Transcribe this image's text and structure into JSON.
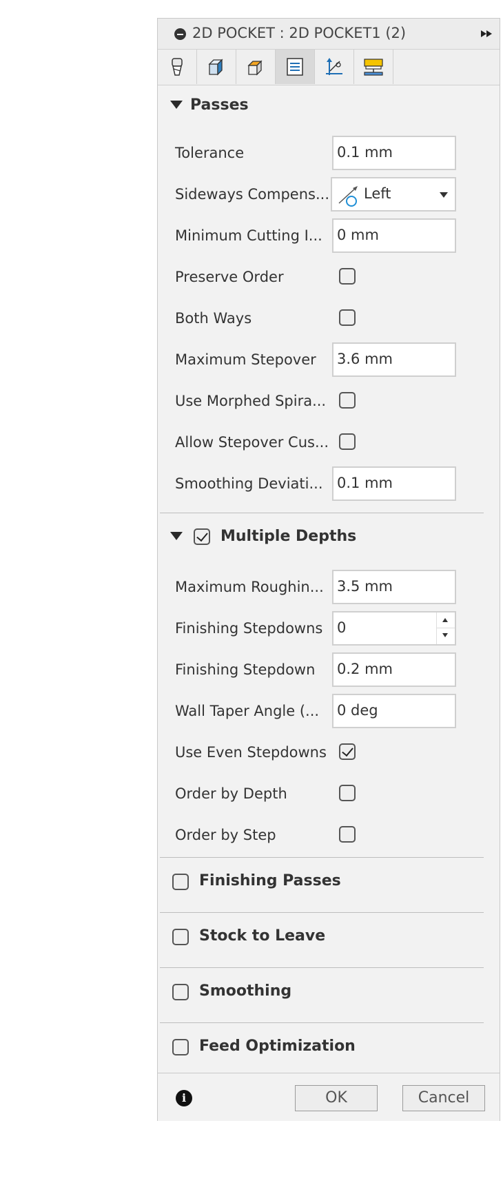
{
  "titlebar": {
    "title": "2D POCKET : 2D POCKET1 (2)",
    "collapse_icon": "collapse-icon",
    "expand_icon": "double-arrow-right-icon"
  },
  "tabs": [
    {
      "name": "tool-tab",
      "icon": "tool-icon",
      "active": false
    },
    {
      "name": "geometry-tab",
      "icon": "geometry-icon",
      "active": false
    },
    {
      "name": "heights-tab",
      "icon": "heights-icon",
      "active": false
    },
    {
      "name": "passes-tab",
      "icon": "passes-icon",
      "active": true
    },
    {
      "name": "linking-tab",
      "icon": "linking-icon",
      "active": false
    },
    {
      "name": "post-process-tab",
      "icon": "post-process-icon",
      "active": false
    }
  ],
  "passes": {
    "header": "Passes",
    "tolerance": {
      "label": "Tolerance",
      "value": "0.1 mm"
    },
    "sideways": {
      "label": "Sideways Compens...",
      "value": "Left"
    },
    "min_cutting": {
      "label": "Minimum Cutting I...",
      "value": "0 mm"
    },
    "preserve_order": {
      "label": "Preserve Order",
      "checked": false
    },
    "both_ways": {
      "label": "Both Ways",
      "checked": false
    },
    "max_stepover": {
      "label": "Maximum Stepover",
      "value": "3.6 mm"
    },
    "morphed_spiral": {
      "label": "Use Morphed Spira...",
      "checked": false
    },
    "allow_stepover": {
      "label": "Allow Stepover Cus...",
      "checked": false
    },
    "smoothing_dev": {
      "label": "Smoothing Deviati...",
      "value": "0.1 mm"
    }
  },
  "multiple_depths": {
    "header": "Multiple Depths",
    "enabled": true,
    "max_roughing": {
      "label": "Maximum Roughin...",
      "value": "3.5 mm"
    },
    "finishing_stepdowns": {
      "label": "Finishing Stepdowns",
      "value": "0"
    },
    "finishing_stepdown": {
      "label": "Finishing Stepdown",
      "value": "0.2 mm"
    },
    "wall_taper": {
      "label": "Wall Taper Angle (...",
      "value": "0 deg"
    },
    "even_stepdowns": {
      "label": "Use Even Stepdowns",
      "checked": true
    },
    "order_depth": {
      "label": "Order by Depth",
      "checked": false
    },
    "order_step": {
      "label": "Order by Step",
      "checked": false
    }
  },
  "collapsed_sections": {
    "finishing_passes": {
      "label": "Finishing Passes",
      "checked": false
    },
    "stock_to_leave": {
      "label": "Stock to Leave",
      "checked": false
    },
    "smoothing": {
      "label": "Smoothing",
      "checked": false
    },
    "feed_optimization": {
      "label": "Feed Optimization",
      "checked": false
    }
  },
  "footer": {
    "info": "i",
    "ok": "OK",
    "cancel": "Cancel"
  }
}
